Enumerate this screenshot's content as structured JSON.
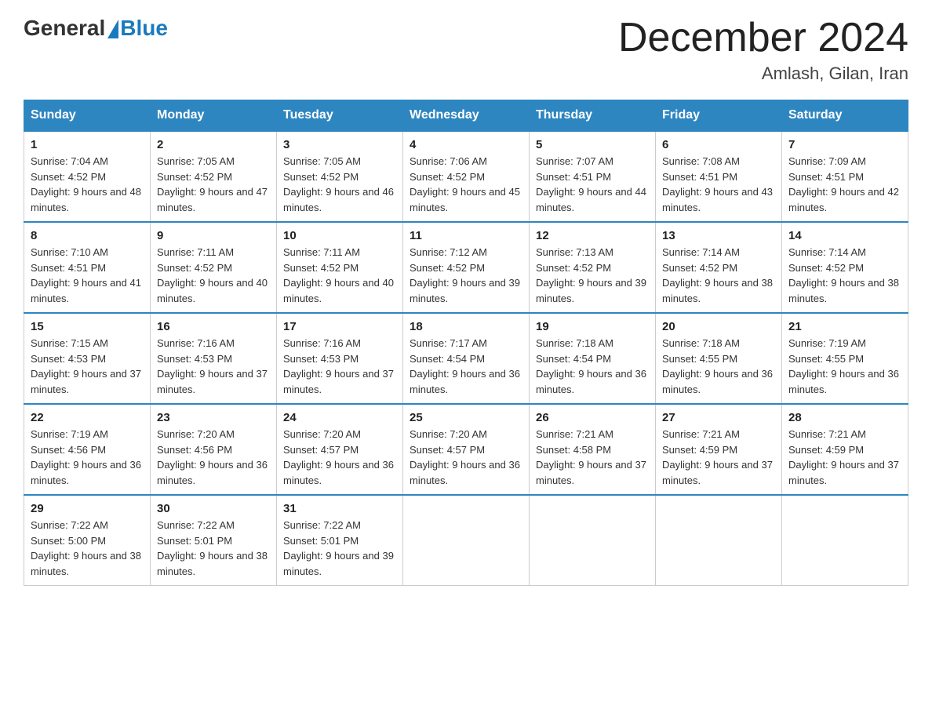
{
  "header": {
    "logo_general": "General",
    "logo_blue": "Blue",
    "main_title": "December 2024",
    "sub_title": "Amlash, Gilan, Iran"
  },
  "days_of_week": [
    "Sunday",
    "Monday",
    "Tuesday",
    "Wednesday",
    "Thursday",
    "Friday",
    "Saturday"
  ],
  "weeks": [
    [
      {
        "day": "1",
        "sunrise": "7:04 AM",
        "sunset": "4:52 PM",
        "daylight": "9 hours and 48 minutes."
      },
      {
        "day": "2",
        "sunrise": "7:05 AM",
        "sunset": "4:52 PM",
        "daylight": "9 hours and 47 minutes."
      },
      {
        "day": "3",
        "sunrise": "7:05 AM",
        "sunset": "4:52 PM",
        "daylight": "9 hours and 46 minutes."
      },
      {
        "day": "4",
        "sunrise": "7:06 AM",
        "sunset": "4:52 PM",
        "daylight": "9 hours and 45 minutes."
      },
      {
        "day": "5",
        "sunrise": "7:07 AM",
        "sunset": "4:51 PM",
        "daylight": "9 hours and 44 minutes."
      },
      {
        "day": "6",
        "sunrise": "7:08 AM",
        "sunset": "4:51 PM",
        "daylight": "9 hours and 43 minutes."
      },
      {
        "day": "7",
        "sunrise": "7:09 AM",
        "sunset": "4:51 PM",
        "daylight": "9 hours and 42 minutes."
      }
    ],
    [
      {
        "day": "8",
        "sunrise": "7:10 AM",
        "sunset": "4:51 PM",
        "daylight": "9 hours and 41 minutes."
      },
      {
        "day": "9",
        "sunrise": "7:11 AM",
        "sunset": "4:52 PM",
        "daylight": "9 hours and 40 minutes."
      },
      {
        "day": "10",
        "sunrise": "7:11 AM",
        "sunset": "4:52 PM",
        "daylight": "9 hours and 40 minutes."
      },
      {
        "day": "11",
        "sunrise": "7:12 AM",
        "sunset": "4:52 PM",
        "daylight": "9 hours and 39 minutes."
      },
      {
        "day": "12",
        "sunrise": "7:13 AM",
        "sunset": "4:52 PM",
        "daylight": "9 hours and 39 minutes."
      },
      {
        "day": "13",
        "sunrise": "7:14 AM",
        "sunset": "4:52 PM",
        "daylight": "9 hours and 38 minutes."
      },
      {
        "day": "14",
        "sunrise": "7:14 AM",
        "sunset": "4:52 PM",
        "daylight": "9 hours and 38 minutes."
      }
    ],
    [
      {
        "day": "15",
        "sunrise": "7:15 AM",
        "sunset": "4:53 PM",
        "daylight": "9 hours and 37 minutes."
      },
      {
        "day": "16",
        "sunrise": "7:16 AM",
        "sunset": "4:53 PM",
        "daylight": "9 hours and 37 minutes."
      },
      {
        "day": "17",
        "sunrise": "7:16 AM",
        "sunset": "4:53 PM",
        "daylight": "9 hours and 37 minutes."
      },
      {
        "day": "18",
        "sunrise": "7:17 AM",
        "sunset": "4:54 PM",
        "daylight": "9 hours and 36 minutes."
      },
      {
        "day": "19",
        "sunrise": "7:18 AM",
        "sunset": "4:54 PM",
        "daylight": "9 hours and 36 minutes."
      },
      {
        "day": "20",
        "sunrise": "7:18 AM",
        "sunset": "4:55 PM",
        "daylight": "9 hours and 36 minutes."
      },
      {
        "day": "21",
        "sunrise": "7:19 AM",
        "sunset": "4:55 PM",
        "daylight": "9 hours and 36 minutes."
      }
    ],
    [
      {
        "day": "22",
        "sunrise": "7:19 AM",
        "sunset": "4:56 PM",
        "daylight": "9 hours and 36 minutes."
      },
      {
        "day": "23",
        "sunrise": "7:20 AM",
        "sunset": "4:56 PM",
        "daylight": "9 hours and 36 minutes."
      },
      {
        "day": "24",
        "sunrise": "7:20 AM",
        "sunset": "4:57 PM",
        "daylight": "9 hours and 36 minutes."
      },
      {
        "day": "25",
        "sunrise": "7:20 AM",
        "sunset": "4:57 PM",
        "daylight": "9 hours and 36 minutes."
      },
      {
        "day": "26",
        "sunrise": "7:21 AM",
        "sunset": "4:58 PM",
        "daylight": "9 hours and 37 minutes."
      },
      {
        "day": "27",
        "sunrise": "7:21 AM",
        "sunset": "4:59 PM",
        "daylight": "9 hours and 37 minutes."
      },
      {
        "day": "28",
        "sunrise": "7:21 AM",
        "sunset": "4:59 PM",
        "daylight": "9 hours and 37 minutes."
      }
    ],
    [
      {
        "day": "29",
        "sunrise": "7:22 AM",
        "sunset": "5:00 PM",
        "daylight": "9 hours and 38 minutes."
      },
      {
        "day": "30",
        "sunrise": "7:22 AM",
        "sunset": "5:01 PM",
        "daylight": "9 hours and 38 minutes."
      },
      {
        "day": "31",
        "sunrise": "7:22 AM",
        "sunset": "5:01 PM",
        "daylight": "9 hours and 39 minutes."
      },
      null,
      null,
      null,
      null
    ]
  ]
}
